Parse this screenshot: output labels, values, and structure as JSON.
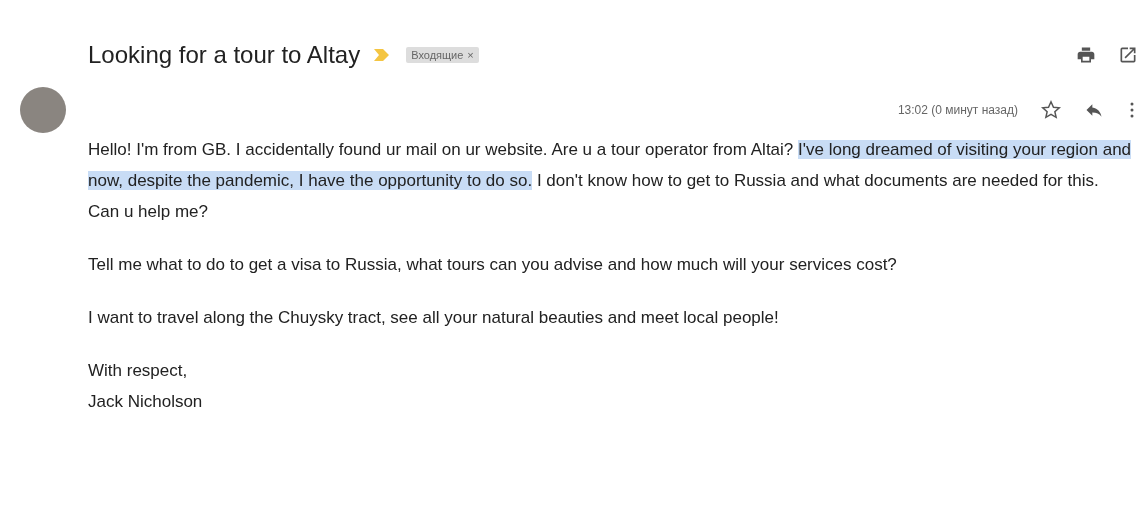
{
  "subject": "Looking for a tour to Altay",
  "important": true,
  "label": {
    "text": "Входящие",
    "close": "×"
  },
  "time": "13:02 (0 минут назад)",
  "starred": false,
  "paragraphs": [
    {
      "segments": [
        {
          "text": "Hello! I'm from GB. I accidentally found ur mail on ur website. Are u a tour operator from Altai? ",
          "highlighted": false
        },
        {
          "text": "I've long dreamed of visiting your region and now, despite the pandemic, I have the opportunity to do so.",
          "highlighted": true
        },
        {
          "text": " I don't know how to get to Russia and what documents are needed for this. Can u help me?",
          "highlighted": false
        }
      ]
    },
    {
      "segments": [
        {
          "text": "Tell me what to do to get a visa to Russia, what tours can you advise and how much will your services cost?",
          "highlighted": false
        }
      ]
    },
    {
      "segments": [
        {
          "text": "I want to travel along the Chuysky tract, see all your natural beauties and meet local people!",
          "highlighted": false
        }
      ]
    }
  ],
  "signature": [
    "With respect,",
    "Jack Nicholson"
  ]
}
